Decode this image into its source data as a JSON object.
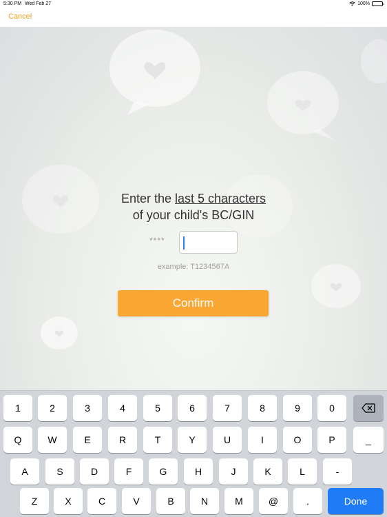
{
  "status_bar": {
    "time": "5:30 PM",
    "date": "Wed Feb 27",
    "battery": "100%"
  },
  "nav": {
    "cancel_label": "Cancel"
  },
  "prompt": {
    "line1_prefix": "Enter the ",
    "line1_underlined": "last 5 characters",
    "line2": "of your child's BC/GIN"
  },
  "input": {
    "mask": "****",
    "value": ""
  },
  "example": "example: T1234567A",
  "confirm_label": "Confirm",
  "colors": {
    "accent": "#fba733",
    "cancel": "#f0a020",
    "done": "#1f7cf6"
  },
  "keyboard": {
    "row1": [
      "1",
      "2",
      "3",
      "4",
      "5",
      "6",
      "7",
      "8",
      "9",
      "0"
    ],
    "row2": [
      "Q",
      "W",
      "E",
      "R",
      "T",
      "Y",
      "U",
      "I",
      "O",
      "P",
      "_"
    ],
    "row3": [
      "A",
      "S",
      "D",
      "F",
      "G",
      "H",
      "J",
      "K",
      "L",
      "-"
    ],
    "row4": [
      "Z",
      "X",
      "C",
      "V",
      "B",
      "N",
      "M",
      "@",
      "."
    ],
    "done_label": "Done",
    "backspace_icon": "backspace-icon"
  }
}
